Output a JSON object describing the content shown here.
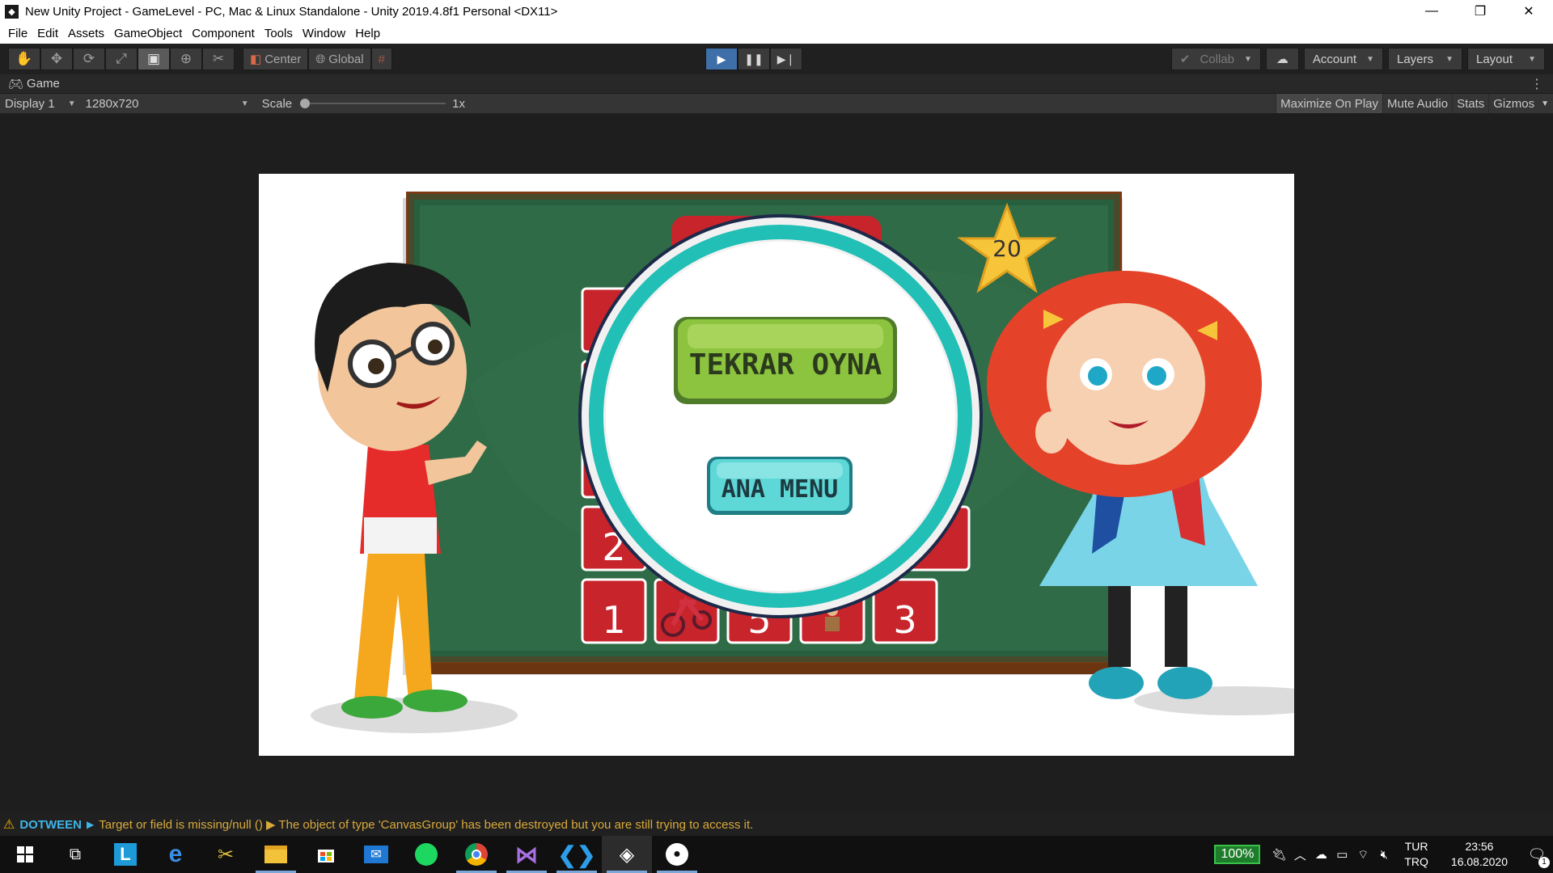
{
  "window": {
    "title": "New Unity Project - GameLevel - PC, Mac & Linux Standalone - Unity 2019.4.8f1 Personal <DX11>",
    "icon": "unity-logo-icon",
    "controls": [
      "minimize-icon",
      "restore-icon",
      "close-icon"
    ]
  },
  "menu": [
    "File",
    "Edit",
    "Assets",
    "GameObject",
    "Component",
    "Tools",
    "Window",
    "Help"
  ],
  "toolbar": {
    "transform_tools": [
      "hand-tool-icon",
      "move-tool-icon",
      "rotate-tool-icon",
      "scale-tool-icon",
      "rect-tool-icon",
      "transform-tool-icon",
      "custom-tool-icon"
    ],
    "active_tool": "rect-tool-icon",
    "pivot_label": "Center",
    "space_label": "Global",
    "snap_icon": "grid-snap-icon",
    "play_state": "playing",
    "collab_label": "Collab",
    "cloud_icon": "cloud-icon",
    "account_label": "Account",
    "layers_label": "Layers",
    "layout_label": "Layout"
  },
  "game_tab": {
    "label": "Game",
    "icon": "gamepad-icon"
  },
  "game_bar": {
    "display": "Display 1",
    "resolution": "1280x720",
    "scale_label": "Scale",
    "scale_value": "1x",
    "scale_fraction": 0.0,
    "maximize_label": "Maximize On Play",
    "mute_label": "Mute Audio",
    "stats_label": "Stats",
    "gizmos_label": "Gizmos"
  },
  "game_screen": {
    "star_score": "20",
    "replay_button": "TEKRAR OYNA",
    "menu_button": "ANA MENU",
    "cards_bottom_row": [
      "1",
      "bicycle",
      "5",
      "soldier",
      "3"
    ],
    "card_partial": "2",
    "colors": {
      "board": "#2e6b46",
      "frame": "#7a3a14",
      "card": "#c8242c",
      "ring": "#21bfb5",
      "replay_green": "#8cc43f",
      "menu_teal": "#5ed7d7",
      "star": "#f7c53a"
    }
  },
  "console": {
    "tag": "DOTWEEN",
    "message": "Target or field is missing/null () ▶ The object of type 'CanvasGroup' has been destroyed but you are still trying to access it."
  },
  "taskbar": {
    "apps": [
      "windows-start-icon",
      "task-view-icon",
      "lightshot-icon",
      "edge-icon",
      "snipping-tool-icon",
      "file-explorer-icon",
      "store-icon",
      "mail-icon",
      "spotify-icon",
      "chrome-icon",
      "visual-studio-icon",
      "vscode-icon",
      "unity-icon",
      "github-icon"
    ],
    "battery": "100%",
    "lang_top": "TUR",
    "lang_bottom": "TRQ",
    "time": "23:56",
    "date": "16.08.2020",
    "notifications": "1"
  }
}
